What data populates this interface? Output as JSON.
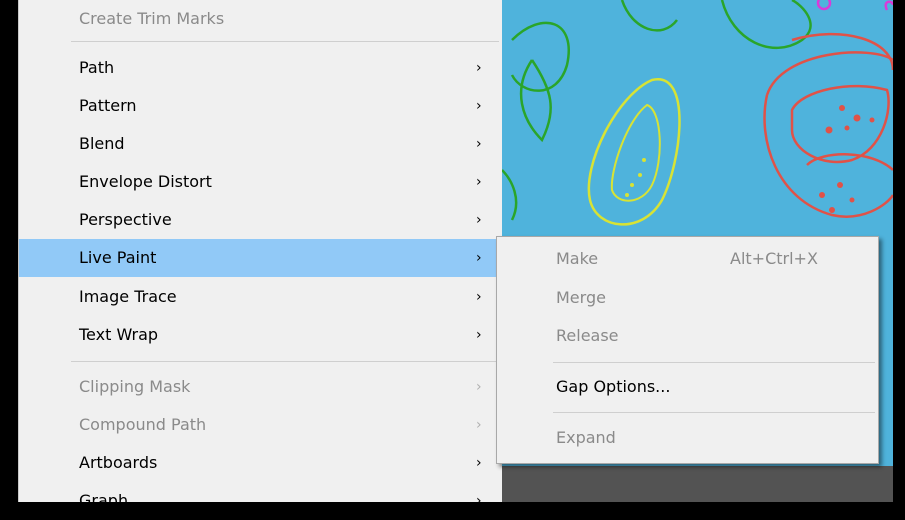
{
  "main_menu": {
    "items": [
      {
        "label": "Create Trim Marks",
        "enabled": false,
        "submenu": false
      },
      {
        "label": "Path",
        "enabled": true,
        "submenu": true
      },
      {
        "label": "Pattern",
        "enabled": true,
        "submenu": true
      },
      {
        "label": "Blend",
        "enabled": true,
        "submenu": true
      },
      {
        "label": "Envelope Distort",
        "enabled": true,
        "submenu": true
      },
      {
        "label": "Perspective",
        "enabled": true,
        "submenu": true
      },
      {
        "label": "Live Paint",
        "enabled": true,
        "submenu": true,
        "highlighted": true
      },
      {
        "label": "Image Trace",
        "enabled": true,
        "submenu": true
      },
      {
        "label": "Text Wrap",
        "enabled": true,
        "submenu": true
      },
      {
        "label": "Clipping Mask",
        "enabled": false,
        "submenu": true
      },
      {
        "label": "Compound Path",
        "enabled": false,
        "submenu": true
      },
      {
        "label": "Artboards",
        "enabled": true,
        "submenu": true
      },
      {
        "label": "Graph",
        "enabled": true,
        "submenu": true
      }
    ],
    "arrow_glyph": "›"
  },
  "live_paint_submenu": {
    "items": [
      {
        "label": "Make",
        "shortcut": "Alt+Ctrl+X",
        "enabled": false
      },
      {
        "label": "Merge",
        "shortcut": "",
        "enabled": false
      },
      {
        "label": "Release",
        "shortcut": "",
        "enabled": false
      },
      {
        "label": "Gap Options...",
        "shortcut": "",
        "enabled": true
      },
      {
        "label": "Expand",
        "shortcut": "",
        "enabled": false
      }
    ]
  },
  "colors": {
    "menu_bg": "#f0f0f0",
    "highlight": "#91c9f7",
    "disabled_text": "#8a8a8a",
    "artboard_bg": "#4fb3dc",
    "pasteboard": "#535353"
  }
}
